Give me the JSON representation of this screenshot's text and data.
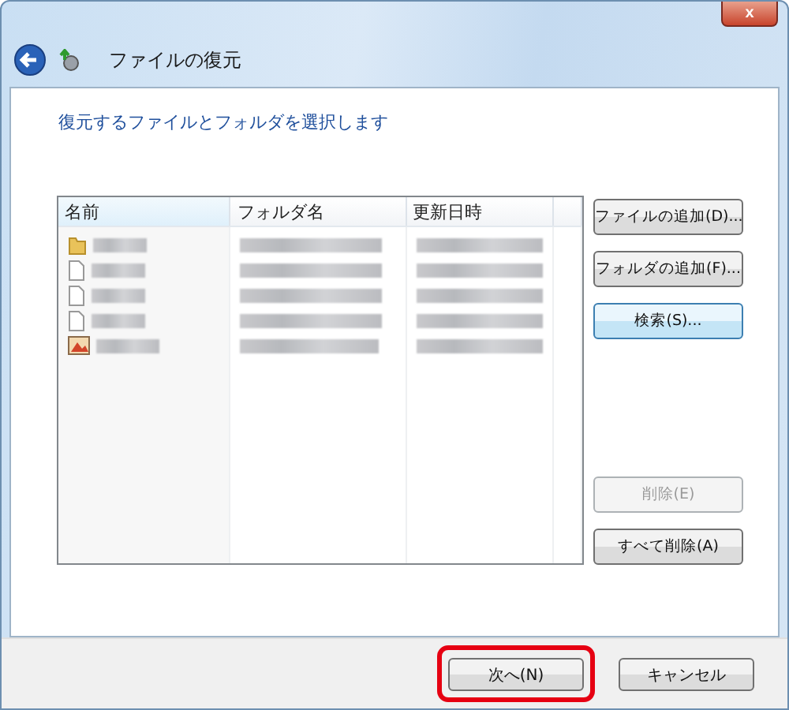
{
  "window": {
    "title": "ファイルの復元",
    "close": "x"
  },
  "instruction": "復元するファイルとフォルダを選択します",
  "table": {
    "columns": [
      "名前",
      "フォルダ名",
      "更新日時"
    ],
    "rows": [
      {
        "kind": "folder"
      },
      {
        "kind": "file"
      },
      {
        "kind": "file"
      },
      {
        "kind": "file"
      },
      {
        "kind": "image"
      }
    ]
  },
  "top_buttons": [
    {
      "label": "ファイルの追加(D)...",
      "disabled": false,
      "default": false
    },
    {
      "label": "フォルダの追加(F)...",
      "disabled": false,
      "default": false
    },
    {
      "label": "検索(S)...",
      "disabled": false,
      "default": true
    }
  ],
  "bottom_buttons": [
    {
      "label": "削除(E)",
      "disabled": true,
      "default": false
    },
    {
      "label": "すべて削除(A)",
      "disabled": false,
      "default": false
    }
  ],
  "footer_buttons": [
    {
      "label": "次へ(N)",
      "highlighted": true
    },
    {
      "label": "キャンセル",
      "highlighted": false
    }
  ]
}
